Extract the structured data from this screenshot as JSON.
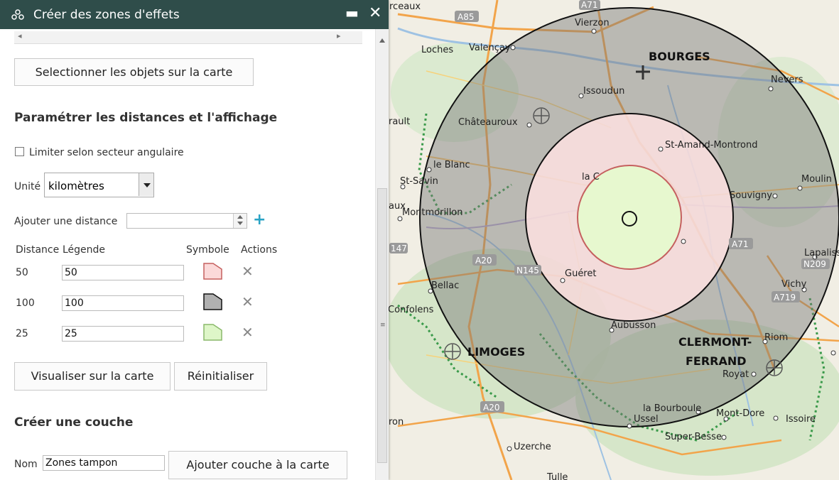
{
  "dialog": {
    "title": "Créer des zones d'effets",
    "minimize_glyph": "▬",
    "close_glyph": "✕"
  },
  "select_button": "Selectionner les objets sur la carte",
  "params": {
    "heading": "Paramétrer les distances et l'affichage",
    "limit_label": "Limiter selon secteur angulaire",
    "limit_checked": false,
    "unit_label": "Unité",
    "unit_value": "kilomètres",
    "add_distance_label": "Ajouter une distance",
    "add_distance_value": ""
  },
  "table": {
    "headers": [
      "Distance",
      "Légende",
      "Symbole",
      "Actions"
    ],
    "rows": [
      {
        "distance": "50",
        "legend": "50",
        "fill": "#fbd9d9",
        "stroke": "#c5605f"
      },
      {
        "distance": "100",
        "legend": "100",
        "fill": "#b0b0b0",
        "stroke": "#111111"
      },
      {
        "distance": "25",
        "legend": "25",
        "fill": "#def6c8",
        "stroke": "#8ab96a"
      }
    ]
  },
  "buttons": {
    "visualize": "Visualiser sur la carte",
    "reset": "Réinitialiser"
  },
  "layer": {
    "heading": "Créer une couche",
    "name_label": "Nom",
    "name_value": "Zones tampon",
    "add_button": "Ajouter couche à la carte"
  },
  "map": {
    "cities_big": [
      "BOURGES",
      "LIMOGES",
      "CLERMONT-",
      "FERRAND"
    ],
    "cities": [
      "Vierzon",
      "Valençay",
      "Loches",
      "Issoudun",
      "Châteauroux",
      "Nevers",
      "St-Amand-Montrond",
      "le Blanc",
      "St-Savin",
      "Montmorillon",
      "Moulin",
      "Souvigny",
      "Guéret",
      "Bellac",
      "Lapalisse",
      "Vichy",
      "Aubusson",
      "Riom",
      "Royat",
      "la Bourboule",
      "Mont-Dore",
      "Issoire",
      "Ussel",
      "Super-Besse",
      "Uzerche",
      "Confolens",
      "rault",
      "aux",
      "la C",
      "Tulle",
      "rceaux",
      "ron"
    ],
    "roads": [
      "A85",
      "A71",
      "A20",
      "N145",
      "A20",
      "A71",
      "A719",
      "N209",
      "147"
    ]
  }
}
